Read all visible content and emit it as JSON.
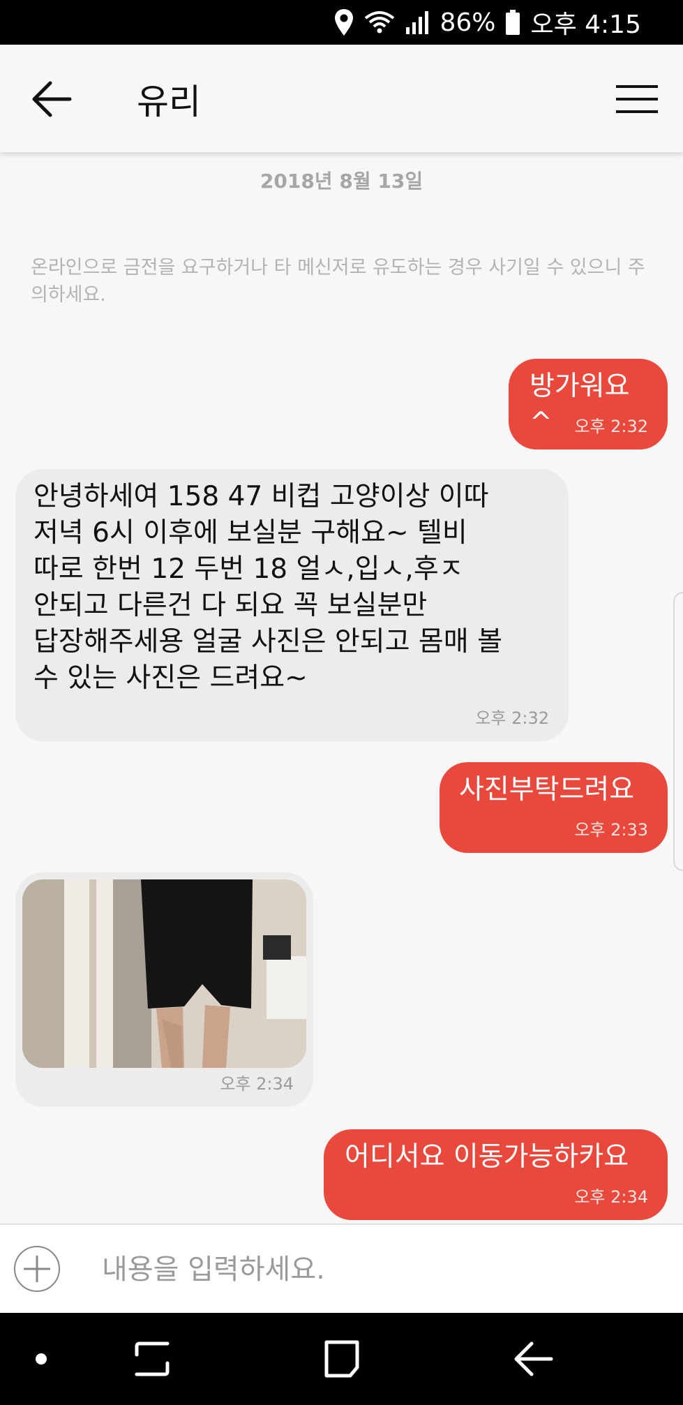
{
  "status_bar": {
    "battery": "86%",
    "time": "오후 4:15"
  },
  "header": {
    "title": "유리"
  },
  "chat": {
    "date": "2018년 8월 13일",
    "notice": "온라인으로 금전을 요구하거나 타 메신저로 유도하는 경우 사기일 수 있으니 주의하세요.",
    "messages": [
      {
        "direction": "outgoing",
        "text": "방가워요^",
        "time": "오후 2:32"
      },
      {
        "direction": "incoming",
        "text": "안녕하세여 158 47 비컵 고양이상 이따\n저녁 6시 이후에 보실분 구해요~ 텔비\n따로 한번 12 두번 18 얼ㅅ,입ㅅ,후ㅈ\n안되고 다른건 다 되요 꼭 보실분만\n답장해주세용 얼굴 사진은 안되고 몸매 볼\n수 있는 사진은 드려요~",
        "time": "오후 2:32"
      },
      {
        "direction": "outgoing",
        "text": "사진부탁드려요",
        "time": "오후 2:33"
      },
      {
        "direction": "incoming",
        "type": "photo",
        "time": "오후 2:34"
      },
      {
        "direction": "outgoing",
        "text": "어디서요 이동가능하카요",
        "time": "오후 2:34"
      }
    ]
  },
  "input": {
    "placeholder": "내용을 입력하세요."
  },
  "colors": {
    "outgoing_bubble": "#e8493c",
    "incoming_bubble": "#ececec",
    "background": "#f7f7f7"
  },
  "icons": [
    "location-icon",
    "wifi-icon",
    "signal-icon",
    "battery-icon",
    "back-arrow-icon",
    "menu-icon",
    "plus-icon",
    "nav-dot-icon",
    "recent-apps-icon",
    "home-icon",
    "nav-back-icon"
  ]
}
